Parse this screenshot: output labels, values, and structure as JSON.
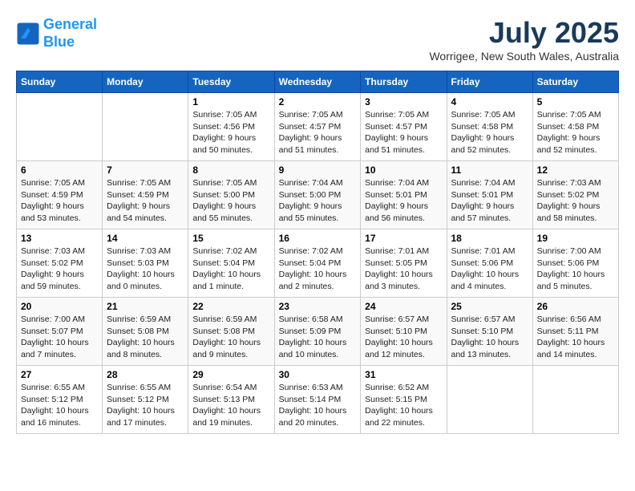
{
  "header": {
    "logo_line1": "General",
    "logo_line2": "Blue",
    "month": "July 2025",
    "location": "Worrigee, New South Wales, Australia"
  },
  "days_of_week": [
    "Sunday",
    "Monday",
    "Tuesday",
    "Wednesday",
    "Thursday",
    "Friday",
    "Saturday"
  ],
  "weeks": [
    [
      {
        "day": "",
        "info": ""
      },
      {
        "day": "",
        "info": ""
      },
      {
        "day": "1",
        "info": "Sunrise: 7:05 AM\nSunset: 4:56 PM\nDaylight: 9 hours and 50 minutes."
      },
      {
        "day": "2",
        "info": "Sunrise: 7:05 AM\nSunset: 4:57 PM\nDaylight: 9 hours and 51 minutes."
      },
      {
        "day": "3",
        "info": "Sunrise: 7:05 AM\nSunset: 4:57 PM\nDaylight: 9 hours and 51 minutes."
      },
      {
        "day": "4",
        "info": "Sunrise: 7:05 AM\nSunset: 4:58 PM\nDaylight: 9 hours and 52 minutes."
      },
      {
        "day": "5",
        "info": "Sunrise: 7:05 AM\nSunset: 4:58 PM\nDaylight: 9 hours and 52 minutes."
      }
    ],
    [
      {
        "day": "6",
        "info": "Sunrise: 7:05 AM\nSunset: 4:59 PM\nDaylight: 9 hours and 53 minutes."
      },
      {
        "day": "7",
        "info": "Sunrise: 7:05 AM\nSunset: 4:59 PM\nDaylight: 9 hours and 54 minutes."
      },
      {
        "day": "8",
        "info": "Sunrise: 7:05 AM\nSunset: 5:00 PM\nDaylight: 9 hours and 55 minutes."
      },
      {
        "day": "9",
        "info": "Sunrise: 7:04 AM\nSunset: 5:00 PM\nDaylight: 9 hours and 55 minutes."
      },
      {
        "day": "10",
        "info": "Sunrise: 7:04 AM\nSunset: 5:01 PM\nDaylight: 9 hours and 56 minutes."
      },
      {
        "day": "11",
        "info": "Sunrise: 7:04 AM\nSunset: 5:01 PM\nDaylight: 9 hours and 57 minutes."
      },
      {
        "day": "12",
        "info": "Sunrise: 7:03 AM\nSunset: 5:02 PM\nDaylight: 9 hours and 58 minutes."
      }
    ],
    [
      {
        "day": "13",
        "info": "Sunrise: 7:03 AM\nSunset: 5:02 PM\nDaylight: 9 hours and 59 minutes."
      },
      {
        "day": "14",
        "info": "Sunrise: 7:03 AM\nSunset: 5:03 PM\nDaylight: 10 hours and 0 minutes."
      },
      {
        "day": "15",
        "info": "Sunrise: 7:02 AM\nSunset: 5:04 PM\nDaylight: 10 hours and 1 minute."
      },
      {
        "day": "16",
        "info": "Sunrise: 7:02 AM\nSunset: 5:04 PM\nDaylight: 10 hours and 2 minutes."
      },
      {
        "day": "17",
        "info": "Sunrise: 7:01 AM\nSunset: 5:05 PM\nDaylight: 10 hours and 3 minutes."
      },
      {
        "day": "18",
        "info": "Sunrise: 7:01 AM\nSunset: 5:06 PM\nDaylight: 10 hours and 4 minutes."
      },
      {
        "day": "19",
        "info": "Sunrise: 7:00 AM\nSunset: 5:06 PM\nDaylight: 10 hours and 5 minutes."
      }
    ],
    [
      {
        "day": "20",
        "info": "Sunrise: 7:00 AM\nSunset: 5:07 PM\nDaylight: 10 hours and 7 minutes."
      },
      {
        "day": "21",
        "info": "Sunrise: 6:59 AM\nSunset: 5:08 PM\nDaylight: 10 hours and 8 minutes."
      },
      {
        "day": "22",
        "info": "Sunrise: 6:59 AM\nSunset: 5:08 PM\nDaylight: 10 hours and 9 minutes."
      },
      {
        "day": "23",
        "info": "Sunrise: 6:58 AM\nSunset: 5:09 PM\nDaylight: 10 hours and 10 minutes."
      },
      {
        "day": "24",
        "info": "Sunrise: 6:57 AM\nSunset: 5:10 PM\nDaylight: 10 hours and 12 minutes."
      },
      {
        "day": "25",
        "info": "Sunrise: 6:57 AM\nSunset: 5:10 PM\nDaylight: 10 hours and 13 minutes."
      },
      {
        "day": "26",
        "info": "Sunrise: 6:56 AM\nSunset: 5:11 PM\nDaylight: 10 hours and 14 minutes."
      }
    ],
    [
      {
        "day": "27",
        "info": "Sunrise: 6:55 AM\nSunset: 5:12 PM\nDaylight: 10 hours and 16 minutes."
      },
      {
        "day": "28",
        "info": "Sunrise: 6:55 AM\nSunset: 5:12 PM\nDaylight: 10 hours and 17 minutes."
      },
      {
        "day": "29",
        "info": "Sunrise: 6:54 AM\nSunset: 5:13 PM\nDaylight: 10 hours and 19 minutes."
      },
      {
        "day": "30",
        "info": "Sunrise: 6:53 AM\nSunset: 5:14 PM\nDaylight: 10 hours and 20 minutes."
      },
      {
        "day": "31",
        "info": "Sunrise: 6:52 AM\nSunset: 5:15 PM\nDaylight: 10 hours and 22 minutes."
      },
      {
        "day": "",
        "info": ""
      },
      {
        "day": "",
        "info": ""
      }
    ]
  ]
}
